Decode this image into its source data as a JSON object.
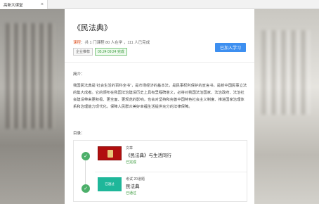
{
  "tab": {
    "title": "高新大课堂",
    "close": "×"
  },
  "course": {
    "title": "《民法典》",
    "meta_tag": "课程",
    "meta_text": "：共 1 门课程 80 人在学 ，111 人已完成",
    "badge_category": "企业推荐",
    "badge_date": "05.24 09:24 完成",
    "join_label": "已加入学习"
  },
  "intro": {
    "heading": "简介：",
    "text": "我国民法典是“社会生活的百科全书”，是市场经济的基本法，是民事权利保护的宣言书，是新中国民事立法的集大成者。它的颁布在我国法治建设历史上具有里程碑意义，必将对我国法治国家、法治政府、法治社会建设带来更积极、更全面、更规范的影响，也会对坚持和完善中国特色社会主义制度、推进国家治理体系和治理能力现代化，保障人民群众美好幸福生活提供充分的法律保障。"
  },
  "toc": {
    "heading": "目录：",
    "items": [
      {
        "type": "文章",
        "name": "《民法典》与生活同行",
        "status": "已完成",
        "thumb_label": ""
      },
      {
        "type": "考试 20道题",
        "name": "民法典",
        "status": "已通过",
        "thumb_label": "已通过"
      }
    ]
  },
  "colors": {
    "accent": "#3d8ff0",
    "success": "#4caf6a",
    "highlight": "#e05a2b"
  }
}
